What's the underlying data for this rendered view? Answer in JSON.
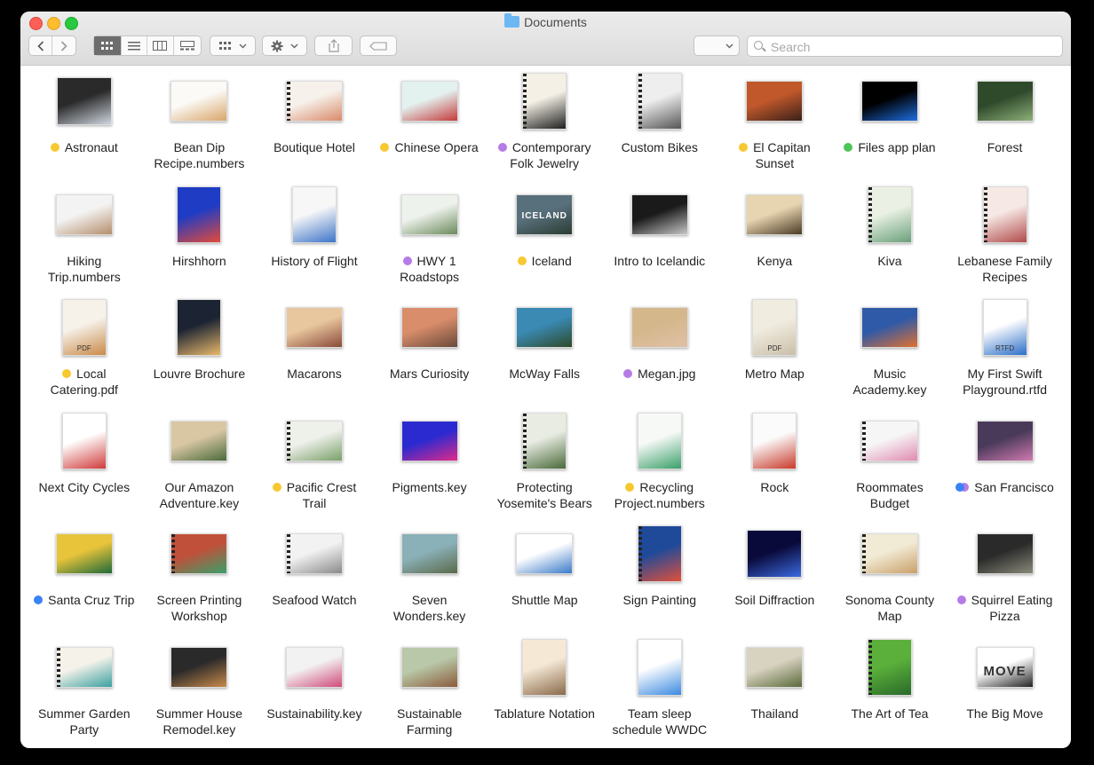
{
  "window": {
    "title": "Documents"
  },
  "toolbar": {
    "back_icon": "chevron-left-icon",
    "forward_icon": "chevron-right-icon",
    "view_modes": [
      "icon-view",
      "list-view",
      "column-view",
      "gallery-view"
    ],
    "active_view": "icon-view",
    "search_placeholder": "Search"
  },
  "items": [
    {
      "name": "Astronaut",
      "tag": "yellow",
      "thumb": "square",
      "colors": [
        "#2a2a2a",
        "#cfd6df"
      ]
    },
    {
      "name": "Bean Dip Recipe.numbers",
      "tag": null,
      "thumb": "landscape",
      "colors": [
        "#fbfaf6",
        "#d9a56a"
      ]
    },
    {
      "name": "Boutique Hotel",
      "tag": null,
      "thumb": "landscape",
      "spiral": true,
      "colors": [
        "#f6f1ea",
        "#d98a6a"
      ]
    },
    {
      "name": "Chinese Opera",
      "tag": "yellow",
      "thumb": "landscape",
      "colors": [
        "#e3f1ef",
        "#c43a3a"
      ]
    },
    {
      "name": "Contemporary Folk Jewelry",
      "tag": "purple",
      "thumb": "portrait",
      "spiral": true,
      "colors": [
        "#f4f0e6",
        "#1e1e1e"
      ]
    },
    {
      "name": "Custom Bikes",
      "tag": null,
      "thumb": "portrait",
      "spiral": true,
      "colors": [
        "#eeeeee",
        "#555555"
      ]
    },
    {
      "name": "El Capitan Sunset",
      "tag": "yellow",
      "thumb": "landscape",
      "colors": [
        "#c0582c",
        "#3a2018"
      ]
    },
    {
      "name": "Files app plan",
      "tag": "green",
      "thumb": "landscape",
      "colors": [
        "#000000",
        "#1e6ee0"
      ]
    },
    {
      "name": "Forest",
      "tag": null,
      "thumb": "landscape",
      "colors": [
        "#2f4a2b",
        "#8fb07a"
      ]
    },
    {
      "name": "Hiking Trip.numbers",
      "tag": null,
      "thumb": "landscape",
      "colors": [
        "#f3f3f3",
        "#b58e6b"
      ]
    },
    {
      "name": "Hirshhorn",
      "tag": null,
      "thumb": "portrait",
      "colors": [
        "#1f3cc4",
        "#e34a3a"
      ]
    },
    {
      "name": "History of Flight",
      "tag": null,
      "thumb": "portrait",
      "colors": [
        "#f7f7f7",
        "#3c74c8"
      ]
    },
    {
      "name": "HWY 1 Roadstops",
      "tag": "purple",
      "thumb": "landscape",
      "colors": [
        "#eef2ec",
        "#6a8a5a"
      ]
    },
    {
      "name": "Iceland",
      "tag": "yellow",
      "thumb": "landscape",
      "colors": [
        "#58707c",
        "#2c3c32"
      ],
      "text": "ICELAND"
    },
    {
      "name": "Intro to Icelandic",
      "tag": null,
      "thumb": "landscape",
      "colors": [
        "#1a1a1a",
        "#c7c7c7"
      ]
    },
    {
      "name": "Kenya",
      "tag": null,
      "thumb": "landscape",
      "colors": [
        "#e7d4b1",
        "#4a3a24"
      ]
    },
    {
      "name": "Kiva",
      "tag": null,
      "thumb": "portrait",
      "spiral": true,
      "colors": [
        "#eaf1e4",
        "#6aa07a"
      ]
    },
    {
      "name": "Lebanese Family Recipes",
      "tag": null,
      "thumb": "portrait",
      "spiral": true,
      "colors": [
        "#f6e8e4",
        "#b04a4a"
      ]
    },
    {
      "name": "Local Catering.pdf",
      "tag": "yellow",
      "thumb": "portrait",
      "colors": [
        "#f6f2ea",
        "#c98a4a"
      ],
      "text": "PDF"
    },
    {
      "name": "Louvre Brochure",
      "tag": null,
      "thumb": "portrait",
      "colors": [
        "#1c2433",
        "#e8b86a"
      ]
    },
    {
      "name": "Macarons",
      "tag": null,
      "thumb": "landscape",
      "colors": [
        "#e9c79e",
        "#8a4a3a"
      ]
    },
    {
      "name": "Mars Curiosity",
      "tag": null,
      "thumb": "landscape",
      "colors": [
        "#d98d6a",
        "#6a4a3a"
      ]
    },
    {
      "name": "McWay Falls",
      "tag": null,
      "thumb": "landscape",
      "colors": [
        "#3a8ab4",
        "#2e4a2a"
      ]
    },
    {
      "name": "Megan.jpg",
      "tag": "purple",
      "thumb": "landscape",
      "colors": [
        "#d4b88c",
        "#e0c0a6"
      ]
    },
    {
      "name": "Metro Map",
      "tag": null,
      "thumb": "portrait",
      "colors": [
        "#f1ece0",
        "#c9bfa8"
      ],
      "text": "PDF"
    },
    {
      "name": "Music Academy.key",
      "tag": null,
      "thumb": "landscape",
      "colors": [
        "#2f5aa8",
        "#e07030"
      ]
    },
    {
      "name": "My First Swift Playground.rtfd",
      "tag": null,
      "thumb": "portrait",
      "colors": [
        "#ffffff",
        "#2a6ec8"
      ],
      "text": "RTFD"
    },
    {
      "name": "Next City Cycles",
      "tag": null,
      "thumb": "portrait",
      "colors": [
        "#ffffff",
        "#d03a3a"
      ]
    },
    {
      "name": "Our Amazon Adventure.key",
      "tag": null,
      "thumb": "landscape",
      "colors": [
        "#d9c7a4",
        "#4a6a3a"
      ]
    },
    {
      "name": "Pacific Crest Trail",
      "tag": "yellow",
      "thumb": "landscape",
      "spiral": true,
      "colors": [
        "#eef0ea",
        "#7aa06a"
      ]
    },
    {
      "name": "Pigments.key",
      "tag": null,
      "thumb": "landscape",
      "colors": [
        "#2a2ad0",
        "#e02a8a"
      ]
    },
    {
      "name": "Protecting Yosemite's Bears",
      "tag": null,
      "thumb": "portrait",
      "spiral": true,
      "colors": [
        "#e8ece2",
        "#4a6a3a"
      ]
    },
    {
      "name": "Recycling Project.numbers",
      "tag": "yellow",
      "thumb": "portrait",
      "colors": [
        "#f7f9f7",
        "#3aa06a"
      ]
    },
    {
      "name": "Rock",
      "tag": null,
      "thumb": "portrait",
      "colors": [
        "#fbfbfb",
        "#c83a2a"
      ]
    },
    {
      "name": "Roommates Budget",
      "tag": null,
      "thumb": "landscape",
      "spiral": true,
      "colors": [
        "#f6f6f6",
        "#e08ab0"
      ]
    },
    {
      "name": "San Francisco",
      "tag": "multi",
      "thumb": "landscape",
      "colors": [
        "#4a3a5a",
        "#d07ab0"
      ]
    },
    {
      "name": "Santa Cruz Trip",
      "tag": "blue",
      "thumb": "landscape",
      "colors": [
        "#e8c43a",
        "#1f6a3a"
      ]
    },
    {
      "name": "Screen Printing Workshop",
      "tag": null,
      "thumb": "landscape",
      "spiral": true,
      "colors": [
        "#c0503a",
        "#3aa06a"
      ]
    },
    {
      "name": "Seafood Watch",
      "tag": null,
      "thumb": "landscape",
      "spiral": true,
      "colors": [
        "#f2f2f2",
        "#8a8a8a"
      ]
    },
    {
      "name": "Seven Wonders.key",
      "tag": null,
      "thumb": "landscape",
      "colors": [
        "#8ab0b8",
        "#5a6a4a"
      ]
    },
    {
      "name": "Shuttle Map",
      "tag": null,
      "thumb": "landscape",
      "colors": [
        "#ffffff",
        "#3a7ac8"
      ]
    },
    {
      "name": "Sign Painting",
      "tag": null,
      "thumb": "portrait",
      "spiral": true,
      "colors": [
        "#1f4a9a",
        "#e0503a"
      ]
    },
    {
      "name": "Soil Diffraction",
      "tag": null,
      "thumb": "square",
      "colors": [
        "#0a0a3a",
        "#3a6ae0"
      ]
    },
    {
      "name": "Sonoma County Map",
      "tag": null,
      "thumb": "landscape",
      "spiral": true,
      "colors": [
        "#f1ead4",
        "#c9a06a"
      ]
    },
    {
      "name": "Squirrel Eating Pizza",
      "tag": "purple",
      "thumb": "landscape",
      "colors": [
        "#2a2a2a",
        "#8a8a7a"
      ]
    },
    {
      "name": "Summer Garden Party",
      "tag": null,
      "thumb": "landscape",
      "spiral": true,
      "colors": [
        "#f5f2ea",
        "#3aa0a0"
      ]
    },
    {
      "name": "Summer House Remodel.key",
      "tag": null,
      "thumb": "landscape",
      "colors": [
        "#2a2a2a",
        "#c98a4a"
      ]
    },
    {
      "name": "Sustainability.key",
      "tag": null,
      "thumb": "landscape",
      "colors": [
        "#f2f2f2",
        "#d04a7a"
      ]
    },
    {
      "name": "Sustainable Farming",
      "tag": null,
      "thumb": "landscape",
      "colors": [
        "#b8c8a8",
        "#8a5a3a"
      ]
    },
    {
      "name": "Tablature Notation",
      "tag": null,
      "thumb": "portrait",
      "colors": [
        "#f5e9d6",
        "#8a6a4a"
      ]
    },
    {
      "name": "Team sleep schedule WWDC",
      "tag": null,
      "thumb": "portrait",
      "colors": [
        "#ffffff",
        "#3a8ae0"
      ]
    },
    {
      "name": "Thailand",
      "tag": null,
      "thumb": "landscape",
      "colors": [
        "#d8d2c0",
        "#5a6a3a"
      ]
    },
    {
      "name": "The Art of Tea",
      "tag": null,
      "thumb": "portrait",
      "spiral": true,
      "colors": [
        "#5ab03a",
        "#2a6a2a"
      ]
    },
    {
      "name": "The Big Move",
      "tag": null,
      "thumb": "landscape",
      "colors": [
        "#ffffff",
        "#222222"
      ],
      "text": "MOVE"
    }
  ]
}
